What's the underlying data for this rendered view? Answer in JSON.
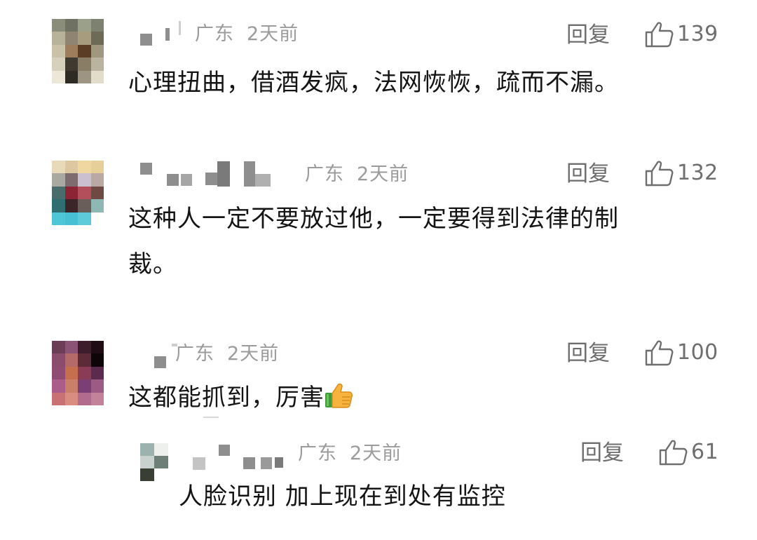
{
  "comments": [
    {
      "location": "广东",
      "time": "2天前",
      "reply_label": "回复",
      "likes": "139",
      "text": "心理扭曲，借酒发疯，法网恢恢，疏而不漏。"
    },
    {
      "location": "广东",
      "time": "2天前",
      "reply_label": "回复",
      "likes": "132",
      "text_line1": "这种人一定不要放过他，一定要得到法律的制",
      "text_line2": "裁。"
    },
    {
      "location": "广东",
      "time": "2天前",
      "reply_label": "回复",
      "likes": "100",
      "text": "这都能抓到，厉害",
      "emoji": "thumbs-up-icon"
    },
    {
      "location": "广东",
      "time": "2天前",
      "reply_label": "回复",
      "likes": "61",
      "text": "人脸识别 加上现在到处有监控"
    }
  ]
}
